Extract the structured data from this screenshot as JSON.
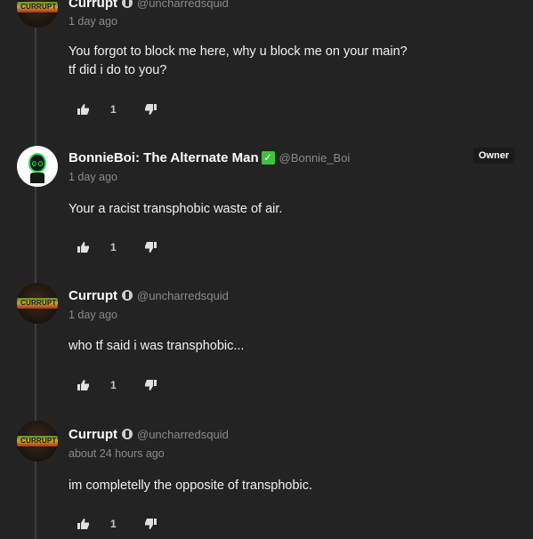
{
  "comments": [
    {
      "author": "Currupt",
      "handle": "@uncharredsquid",
      "time": "1 day ago",
      "text_lines": [
        "You forgot to block me here, why u block me on your main?",
        "tf did i do to you?"
      ],
      "likes": "1",
      "avatar_text": "CURRUPT"
    },
    {
      "author": "BonnieBoi: The Alternate Man",
      "handle": "@Bonnie_Boi",
      "time": "1 day ago",
      "text_lines": [
        "Your a racist transphobic waste of air."
      ],
      "likes": "1",
      "badge": "Owner",
      "verified_glyph": "✓"
    },
    {
      "author": "Currupt",
      "handle": "@uncharredsquid",
      "time": "1 day ago",
      "text_lines": [
        "who tf said i was transphobic..."
      ],
      "likes": "1",
      "avatar_text": "CURRUPT"
    },
    {
      "author": "Currupt",
      "handle": "@uncharredsquid",
      "time": "about 24 hours ago",
      "text_lines": [
        "im completelly the opposite of transphobic."
      ],
      "likes": "1",
      "avatar_text": "CURRUPT"
    }
  ],
  "icons": {
    "like": "thumbs-up-icon",
    "dislike": "thumbs-down-icon",
    "creator_badge": "creator-badge-icon",
    "verified": "verified-check-icon"
  },
  "colors": {
    "background": "#232323",
    "verified": "#3ec23e",
    "bonnie_accent": "#27e05a"
  }
}
